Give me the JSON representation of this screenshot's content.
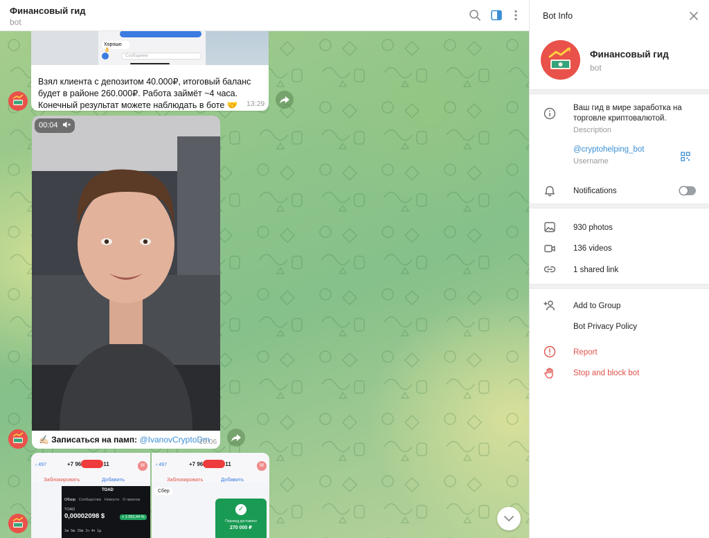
{
  "header": {
    "title": "Финансовый гид",
    "subtitle": "bot",
    "icons": [
      "search-icon",
      "sidebar-toggle-icon",
      "more-vertical-icon"
    ]
  },
  "messages": {
    "screenshot_preview": {
      "bubble_text": "Хорошо 👌",
      "input_placeholder": "Сообщение"
    },
    "text_message": {
      "text": "Взял клиента с депозитом 40.000₽, итоговый баланс будет в районе 260.000₽. Работа займёт ~4 часа. Конечный результат можете наблюдать в боте 🤝",
      "time": "13:29"
    },
    "video_message": {
      "duration": "00:04",
      "caption_prefix": "✍🏻 Записаться на памп: ",
      "caption_link": "@IvanovCryptoDm",
      "time": "16:06"
    },
    "album": {
      "left": {
        "back_count": "497",
        "phone": "+7 96",
        "phone_tail": "11",
        "avatar_letter": "M",
        "block_label": "Заблокировать",
        "add_label": "Добавить",
        "app_name": "TOAD",
        "tabs": [
          "Обзор",
          "Сообщества",
          "Новости",
          "О прилож."
        ],
        "token": "TOAD",
        "price": "0,00002098 $",
        "change": "+ 1 052,44 %",
        "intervals": [
          "1м",
          "5м",
          "15м",
          "1ч",
          "4ч",
          "1д"
        ]
      },
      "right": {
        "back_count": "497",
        "phone": "+7 96",
        "phone_tail": "11",
        "avatar_letter": "M",
        "block_label": "Заблокировать",
        "add_label": "Добавить",
        "bubble": "Сбер",
        "bank_title": "Перевод доставлен",
        "bank_amount": "270 000 ₽"
      }
    }
  },
  "panel": {
    "title": "Bot Info",
    "bot_name": "Финансовый гид",
    "bot_status": "bot",
    "description": "Ваш гид в мире заработка на торговле криптовалютой.",
    "description_label": "Description",
    "username": "@cryptohelping_bot",
    "username_label": "Username",
    "notifications_label": "Notifications",
    "notifications_on": false,
    "media": {
      "photos": "930 photos",
      "videos": "136 videos",
      "links": "1 shared link"
    },
    "actions": {
      "add_to_group": "Add to Group",
      "privacy": "Bot Privacy Policy",
      "report": "Report",
      "stop": "Stop and block bot"
    }
  },
  "colors": {
    "accent": "#3a8ed4",
    "danger": "#e0524a",
    "avatar_bg": "#e9524a"
  }
}
